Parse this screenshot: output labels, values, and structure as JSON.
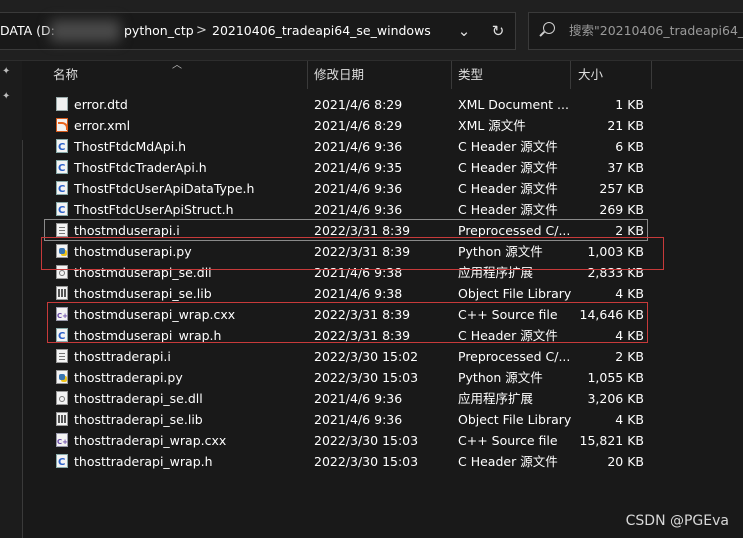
{
  "breadcrumb": {
    "drive": "DATA (D:",
    "folder1": "python_ctp",
    "folder2": "20210406_tradeapi64_se_windows",
    "separator": ">"
  },
  "address_buttons": {
    "history": "⌄",
    "refresh": "↻"
  },
  "search": {
    "placeholder": "搜索\"20210406_tradeapi64_se_"
  },
  "columns": {
    "name": "名称",
    "date": "修改日期",
    "type": "类型",
    "size": "大小"
  },
  "files": [
    {
      "name": "error.dtd",
      "date": "2021/4/6 8:29",
      "type": "XML Document ...",
      "size": "1 KB",
      "icon": "doc-icon"
    },
    {
      "name": "error.xml",
      "date": "2021/4/6 8:29",
      "type": "XML 源文件",
      "size": "21 KB",
      "icon": "xml-icon"
    },
    {
      "name": "ThostFtdcMdApi.h",
      "date": "2021/4/6 9:36",
      "type": "C Header 源文件",
      "size": "6 KB",
      "icon": "c-header-icon"
    },
    {
      "name": "ThostFtdcTraderApi.h",
      "date": "2021/4/6 9:35",
      "type": "C Header 源文件",
      "size": "37 KB",
      "icon": "c-header-icon"
    },
    {
      "name": "ThostFtdcUserApiDataType.h",
      "date": "2021/4/6 9:36",
      "type": "C Header 源文件",
      "size": "257 KB",
      "icon": "c-header-icon"
    },
    {
      "name": "ThostFtdcUserApiStruct.h",
      "date": "2021/4/6 9:36",
      "type": "C Header 源文件",
      "size": "269 KB",
      "icon": "c-header-icon"
    },
    {
      "name": "thostmduserapi.i",
      "date": "2022/3/31 8:39",
      "type": "Preprocessed C/...",
      "size": "2 KB",
      "icon": "text-file-icon"
    },
    {
      "name": "thostmduserapi.py",
      "date": "2022/3/31 8:39",
      "type": "Python 源文件",
      "size": "1,003 KB",
      "icon": "python-file-icon"
    },
    {
      "name": "thostmduserapi_se.dll",
      "date": "2021/4/6 9:38",
      "type": "应用程序扩展",
      "size": "2,833 KB",
      "icon": "dll-icon"
    },
    {
      "name": "thostmduserapi_se.lib",
      "date": "2021/4/6 9:38",
      "type": "Object File Library",
      "size": "4 KB",
      "icon": "library-icon"
    },
    {
      "name": "thostmduserapi_wrap.cxx",
      "date": "2022/3/31 8:39",
      "type": "C++ Source file",
      "size": "14,646 KB",
      "icon": "cpp-source-icon"
    },
    {
      "name": "thostmduserapi_wrap.h",
      "date": "2022/3/31 8:39",
      "type": "C Header 源文件",
      "size": "4 KB",
      "icon": "c-header-icon"
    },
    {
      "name": "thosttraderapi.i",
      "date": "2022/3/30 15:02",
      "type": "Preprocessed C/...",
      "size": "2 KB",
      "icon": "text-file-icon"
    },
    {
      "name": "thosttraderapi.py",
      "date": "2022/3/30 15:03",
      "type": "Python 源文件",
      "size": "1,055 KB",
      "icon": "python-file-icon"
    },
    {
      "name": "thosttraderapi_se.dll",
      "date": "2021/4/6 9:36",
      "type": "应用程序扩展",
      "size": "3,206 KB",
      "icon": "dll-icon"
    },
    {
      "name": "thosttraderapi_se.lib",
      "date": "2021/4/6 9:36",
      "type": "Object File Library",
      "size": "4 KB",
      "icon": "library-icon"
    },
    {
      "name": "thosttraderapi_wrap.cxx",
      "date": "2022/3/30 15:03",
      "type": "C++ Source file",
      "size": "15,821 KB",
      "icon": "cpp-source-icon"
    },
    {
      "name": "thosttraderapi_wrap.h",
      "date": "2022/3/30 15:03",
      "type": "C Header 源文件",
      "size": "20 KB",
      "icon": "c-header-icon"
    }
  ],
  "highlight_color": "#c73a3a",
  "watermark": "CSDN @PGEva"
}
